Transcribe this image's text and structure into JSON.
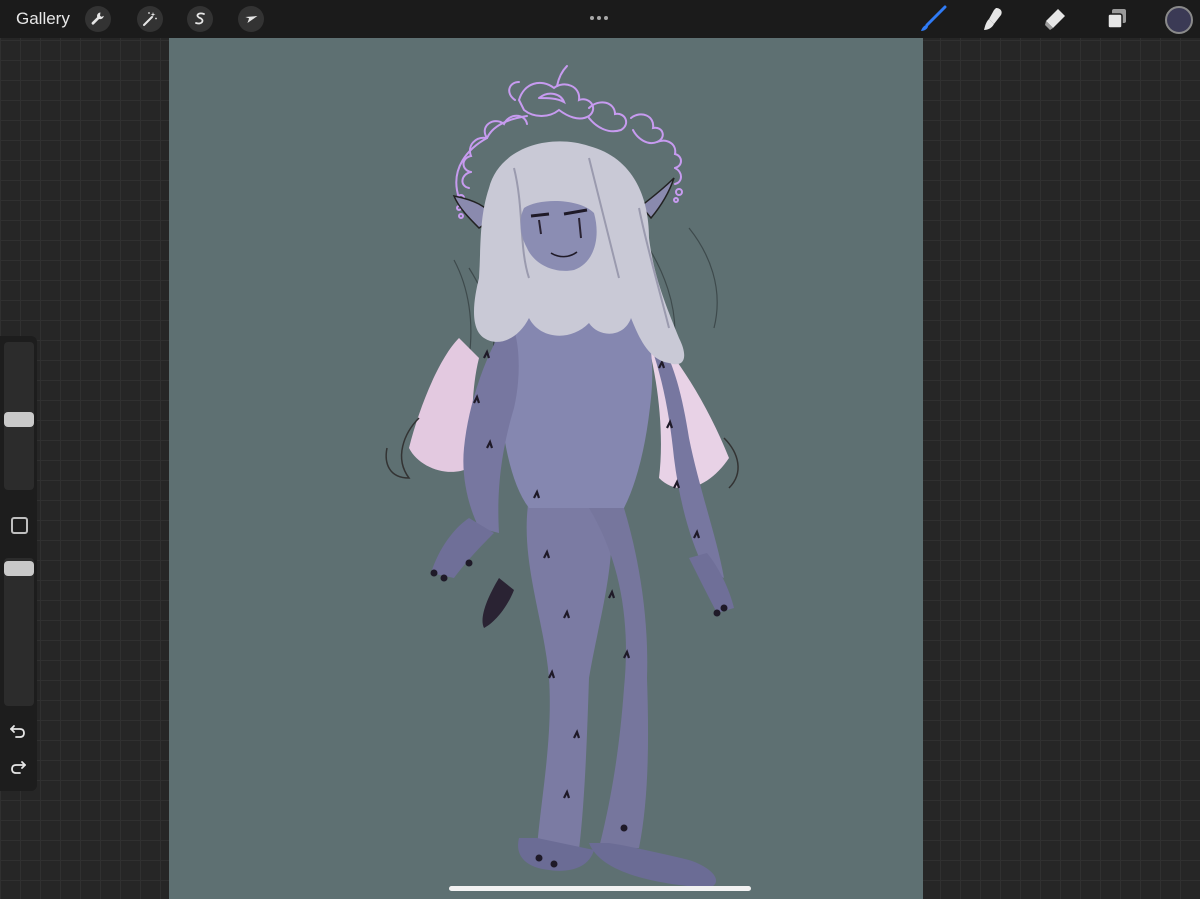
{
  "topbar": {
    "gallery_label": "Gallery"
  },
  "icons": {
    "actions": "wrench-icon",
    "adjustments": "magic-wand-icon",
    "selection": "selection-s-icon",
    "transform": "arrow-cursor-icon",
    "more": "ellipsis-icon",
    "brush": "brush-icon",
    "smudge": "smudge-icon",
    "eraser": "eraser-icon",
    "layers": "layers-icon",
    "undo": "undo-icon",
    "redo": "redo-icon"
  },
  "colors": {
    "canvas_background": "#5e7072",
    "active_tool": "#2f7bf6",
    "current_color": "#3b3a55",
    "figure_skin": "#7b7ba3",
    "hair": "#c9c9d6",
    "halo_outline": "#c79bf0",
    "hair_tips_pink": "#e8cfe6"
  },
  "sidebar": {
    "brush_size_level": 0.55,
    "opacity_level": 0.98
  }
}
